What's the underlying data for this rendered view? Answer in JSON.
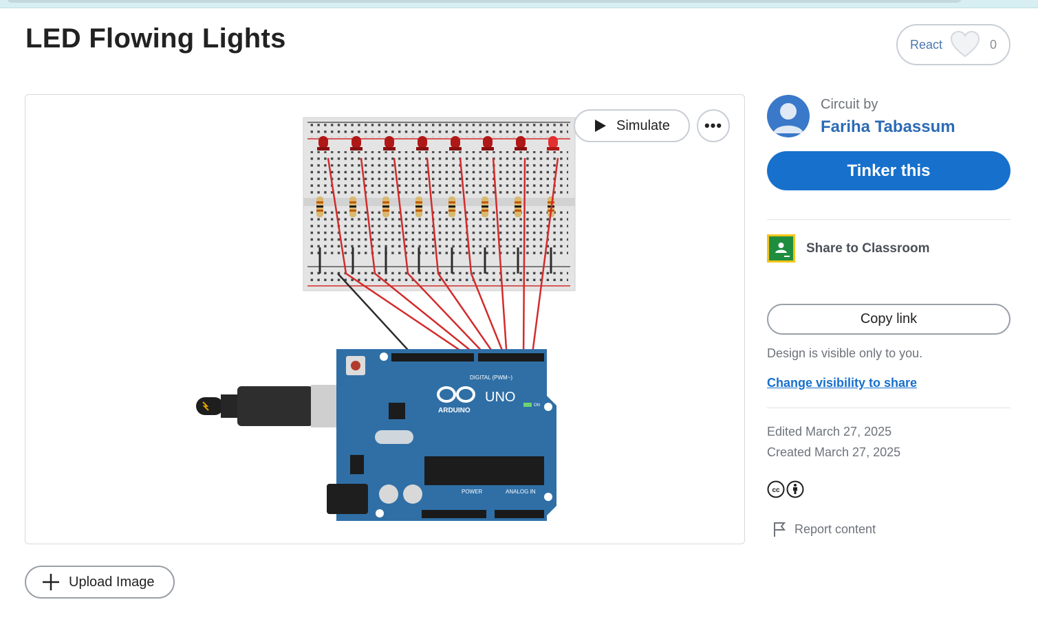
{
  "project": {
    "title": "LED Flowing Lights"
  },
  "react": {
    "label": "React",
    "count": "0",
    "icon": "heart-icon"
  },
  "canvas": {
    "simulate_label": "Simulate",
    "more_label": "•••",
    "board": {
      "name": "UNO",
      "brand": "ARDUINO",
      "digital_header": "DIGITAL (PWM~)",
      "power_header": "POWER",
      "analog_header": "ANALOG IN",
      "on_label": "ON",
      "led_count": 8,
      "wire_color": "#d22b2b",
      "ground_wire_color": "#2b2b2b"
    }
  },
  "upload": {
    "label": "Upload Image",
    "icon": "plus-icon"
  },
  "sidebar": {
    "circuit_by_label": "Circuit by",
    "author": "Fariha Tabassum",
    "tinker_label": "Tinker this",
    "share_classroom_label": "Share to Classroom",
    "copy_link_label": "Copy link",
    "visibility_note": "Design is visible only to you.",
    "change_visibility_label": "Change visibility to share",
    "edited": "Edited March 27, 2025",
    "created": "Created March 27, 2025",
    "license_icons": [
      "cc-icon",
      "by-attribution-icon"
    ],
    "report_label": "Report content"
  },
  "colors": {
    "primary_blue": "#1770cc",
    "author_blue": "#2c6bb5",
    "board_blue": "#2f6fa6",
    "led_red": "#b01818"
  }
}
